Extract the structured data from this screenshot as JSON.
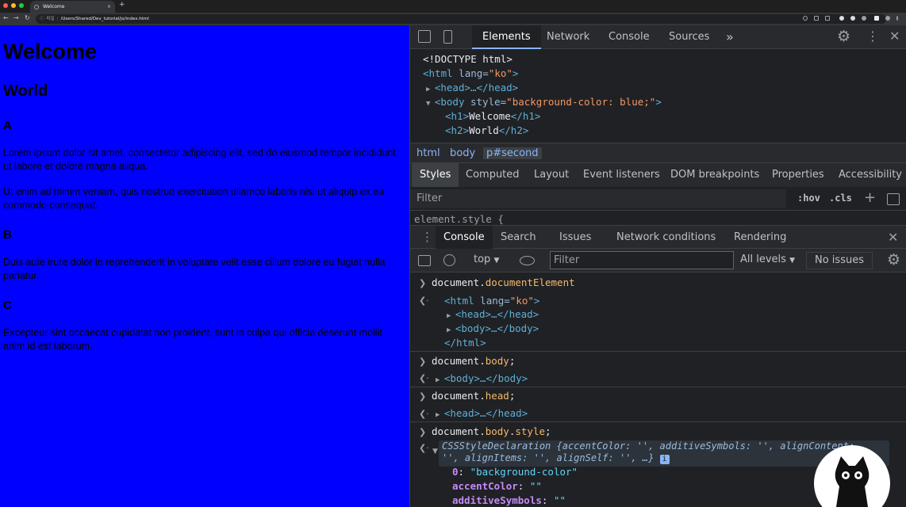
{
  "browser": {
    "tab_title": "Welcome",
    "new_tab": "+",
    "tab_close": "×",
    "url_scheme": "파일",
    "url": "/Users/Shared/Dev_tutorial/js/index.html"
  },
  "page": {
    "h1": "Welcome",
    "h2": "World",
    "sections": [
      {
        "heading": "A",
        "paragraphs": [
          "Lorem ipsum dolor sit amet, consectetur adipiscing elit, sed do eiusmod tempor incididunt ut labore et dolore magna aliqua.",
          "Ut enim ad minim veniam, quis nostrud exercitation ullamco laboris nisi ut aliquip ex ea commodo consequat."
        ]
      },
      {
        "heading": "B",
        "paragraphs": [
          "Duis aute irure dolor in reprehenderit in voluptate velit esse cillum dolore eu fugiat nulla pariatur."
        ]
      },
      {
        "heading": "C",
        "paragraphs": [
          "Excepteur sint occaecat cupidatat non proident, sunt in culpa qui officia deserunt mollit anim id est laborum."
        ]
      }
    ],
    "background_color": "#0000ff"
  },
  "devtools": {
    "tabs": [
      "Elements",
      "Network",
      "Console",
      "Sources"
    ],
    "more_tabs": "»",
    "elements": {
      "doctype": "<!DOCTYPE html>",
      "html_open": "<html",
      "html_attr": " lang=",
      "html_val": "\"ko\"",
      "html_close": ">",
      "head": "<head>…</head>",
      "body_open": "<body",
      "body_attr": " style=",
      "body_val": "\"background-color: blue;\"",
      "body_close": ">",
      "h1_open": "<h1>",
      "h1_text": "Welcome",
      "h1_close": "</h1>",
      "h2_open": "<h2>",
      "h2_text": "World",
      "h2_close": "</h2>"
    },
    "breadcrumbs": [
      "html",
      "body",
      "p#second"
    ],
    "styles_tabs": [
      "Styles",
      "Computed",
      "Layout",
      "Event listeners",
      "DOM breakpoints",
      "Properties",
      "Accessibility"
    ],
    "styles_filter_placeholder": "Filter",
    "hov": ":hov",
    "cls": ".cls",
    "element_style": "element.style {",
    "drawer_tabs": [
      "Console",
      "Search",
      "Issues",
      "Network conditions",
      "Rendering"
    ],
    "console_toolbar": {
      "context": "top",
      "filter_placeholder": "Filter",
      "levels": "All levels",
      "issues": "No issues"
    },
    "console": {
      "cmd1_a": "document.",
      "cmd1_b": "documentElement",
      "out1_html_open": "<html",
      "out1_html_attr": " lang=",
      "out1_html_val": "\"ko\"",
      "out1_html_close": ">",
      "out1_head": "<head>…</head>",
      "out1_body": "<body>…</body>",
      "out1_html_end": "</html>",
      "cmd2_a": "document.",
      "cmd2_b": "body",
      "cmd2_c": ";",
      "out2": "<body>…</body>",
      "cmd3_a": "document.",
      "cmd3_b": "head",
      "cmd3_c": ";",
      "out3": "<head>…</head>",
      "cmd4_a": "document.",
      "cmd4_b": "body",
      "cmd4_c": ".",
      "cmd4_d": "style",
      "cmd4_e": ";",
      "out4_line1": "CSSStyleDeclaration {accentColor: '', additiveSymbols: '', alignContent:",
      "out4_line2": "'', alignItems: '', alignSelf: '', …}",
      "out4_info": "i",
      "prop0_key": "0",
      "prop0_val": "\"background-color\"",
      "prop1_key": "accentColor",
      "prop1_val": "\"\"",
      "prop2_key": "additiveSymbols",
      "prop2_val": "\"\""
    }
  }
}
